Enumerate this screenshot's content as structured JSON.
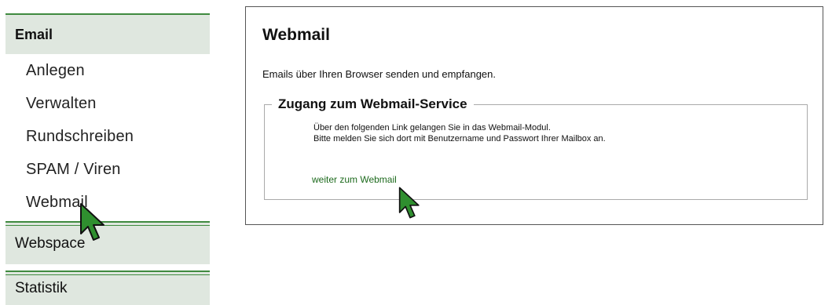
{
  "sidebar": {
    "email_header": "Email",
    "items": [
      {
        "label": "Anlegen"
      },
      {
        "label": "Verwalten"
      },
      {
        "label": "Rundschreiben"
      },
      {
        "label": "SPAM / Viren"
      },
      {
        "label": "Webmail"
      }
    ],
    "webspace_header": "Webspace",
    "statistik_header": "Statistik"
  },
  "main": {
    "title": "Webmail",
    "description": "Emails über Ihren Browser senden und empfangen.",
    "fieldset": {
      "legend": "Zugang zum Webmail-Service",
      "line1": "Über den folgenden Link gelangen Sie in das Webmail-Modul.",
      "line2": "Bitte melden Sie sich dort mit Benutzername und Passwort Ihrer Mailbox an.",
      "link_label": "weiter zum Webmail"
    }
  },
  "colors": {
    "accent_green": "#3f8a3f",
    "header_bg": "#dfe7df",
    "link_green": "#1d6a1d",
    "cursor_green": "#2f8f2f"
  },
  "icons": [
    "arrow-cursor-icon"
  ]
}
